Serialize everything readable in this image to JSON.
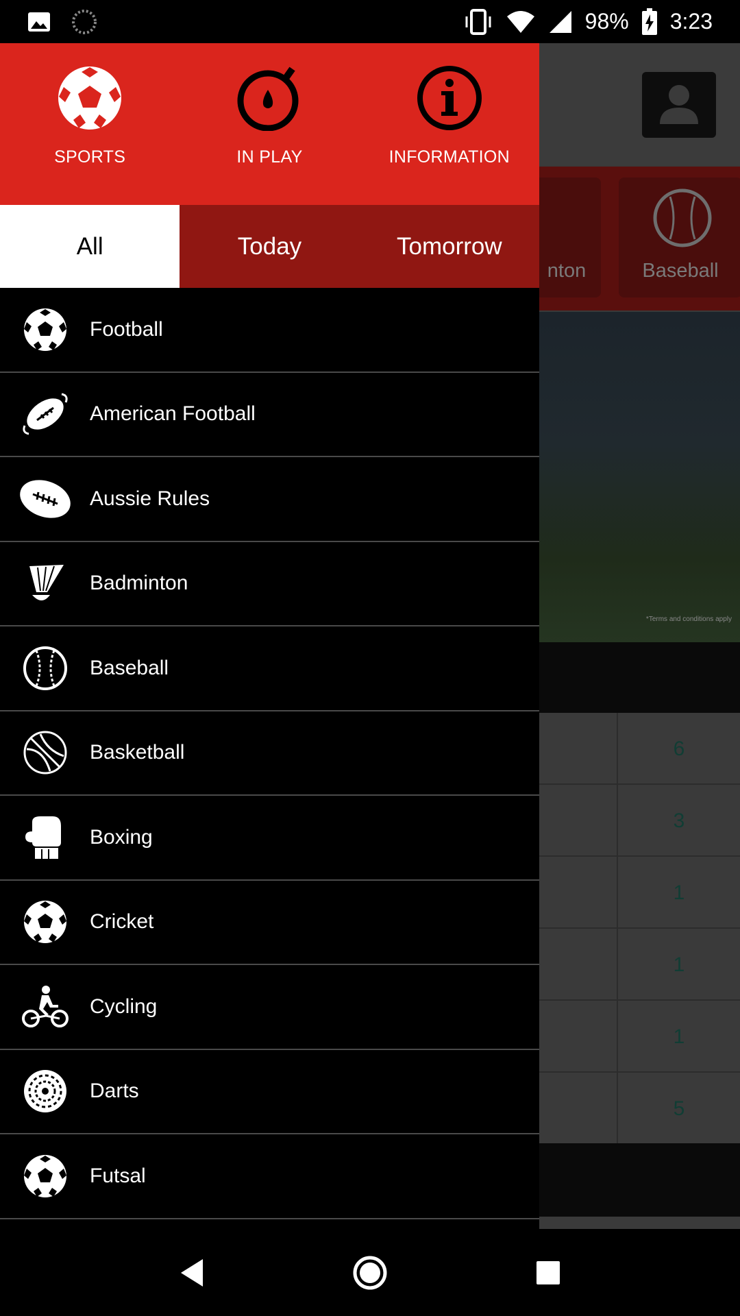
{
  "status_bar": {
    "battery": "98%",
    "time": "3:23",
    "icons": [
      "image-icon",
      "loading-icon",
      "vibrate-icon",
      "wifi-icon",
      "signal-icon",
      "battery-charging-icon"
    ]
  },
  "drawer": {
    "header_buttons": [
      {
        "label": "SPORTS",
        "icon": "soccer-ball-icon"
      },
      {
        "label": "IN PLAY",
        "icon": "stopwatch-icon"
      },
      {
        "label": "INFORMATION",
        "icon": "info-icon"
      }
    ],
    "tabs": [
      {
        "label": "All",
        "active": true
      },
      {
        "label": "Today",
        "active": false
      },
      {
        "label": "Tomorrow",
        "active": false
      }
    ],
    "sports": [
      {
        "label": "Football",
        "icon": "football-icon"
      },
      {
        "label": "American Football",
        "icon": "american-football-icon"
      },
      {
        "label": "Aussie Rules",
        "icon": "aussie-rules-icon"
      },
      {
        "label": "Badminton",
        "icon": "shuttlecock-icon"
      },
      {
        "label": "Baseball",
        "icon": "baseball-icon"
      },
      {
        "label": "Basketball",
        "icon": "basketball-icon"
      },
      {
        "label": "Boxing",
        "icon": "boxing-glove-icon"
      },
      {
        "label": "Cricket",
        "icon": "cricket-icon"
      },
      {
        "label": "Cycling",
        "icon": "cyclist-icon"
      },
      {
        "label": "Darts",
        "icon": "dartboard-icon"
      },
      {
        "label": "Futsal",
        "icon": "futsal-icon"
      }
    ]
  },
  "background": {
    "categories": [
      {
        "label": "nton"
      },
      {
        "label": "Baseball"
      }
    ],
    "banner_terms": "*Terms and conditions apply",
    "counts": [
      "6",
      "3",
      "1",
      "1",
      "1",
      "5"
    ]
  },
  "colors": {
    "header_red": "#da251d",
    "tab_dark_red": "#901712",
    "divider": "#4a4a4a"
  },
  "nav_bar": {
    "icons": [
      "back-icon",
      "home-icon",
      "recents-icon"
    ]
  }
}
